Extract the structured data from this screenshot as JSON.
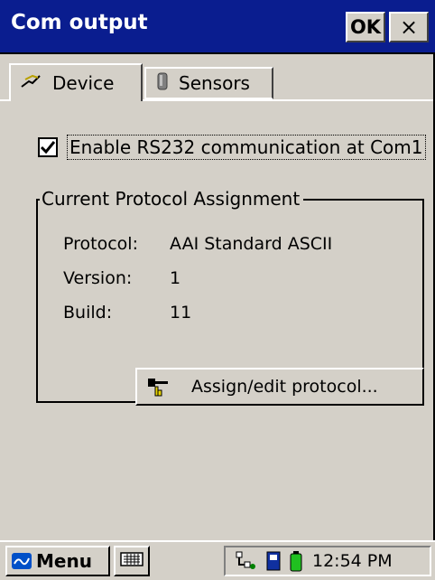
{
  "window": {
    "title": "Com output",
    "ok_label": "OK",
    "close_label": "×"
  },
  "tabs": [
    {
      "label": "Device",
      "icon": "device-icon",
      "active": true
    },
    {
      "label": "Sensors",
      "icon": "sensor-icon",
      "active": false
    }
  ],
  "device": {
    "enable_label": "Enable RS232 communication at Com1",
    "enable_checked": true,
    "group_title": "Current Protocol Assignment",
    "fields": [
      {
        "key": "Protocol:",
        "value": "AAI Standard ASCII"
      },
      {
        "key": "Version:",
        "value": "1"
      },
      {
        "key": "Build:",
        "value": "11"
      }
    ],
    "assign_button": "Assign/edit protocol..."
  },
  "taskbar": {
    "menu_label": "Menu",
    "clock": "12:54 PM"
  },
  "colors": {
    "titlebar": "#0a1d8f",
    "face": "#d4d0c8"
  }
}
